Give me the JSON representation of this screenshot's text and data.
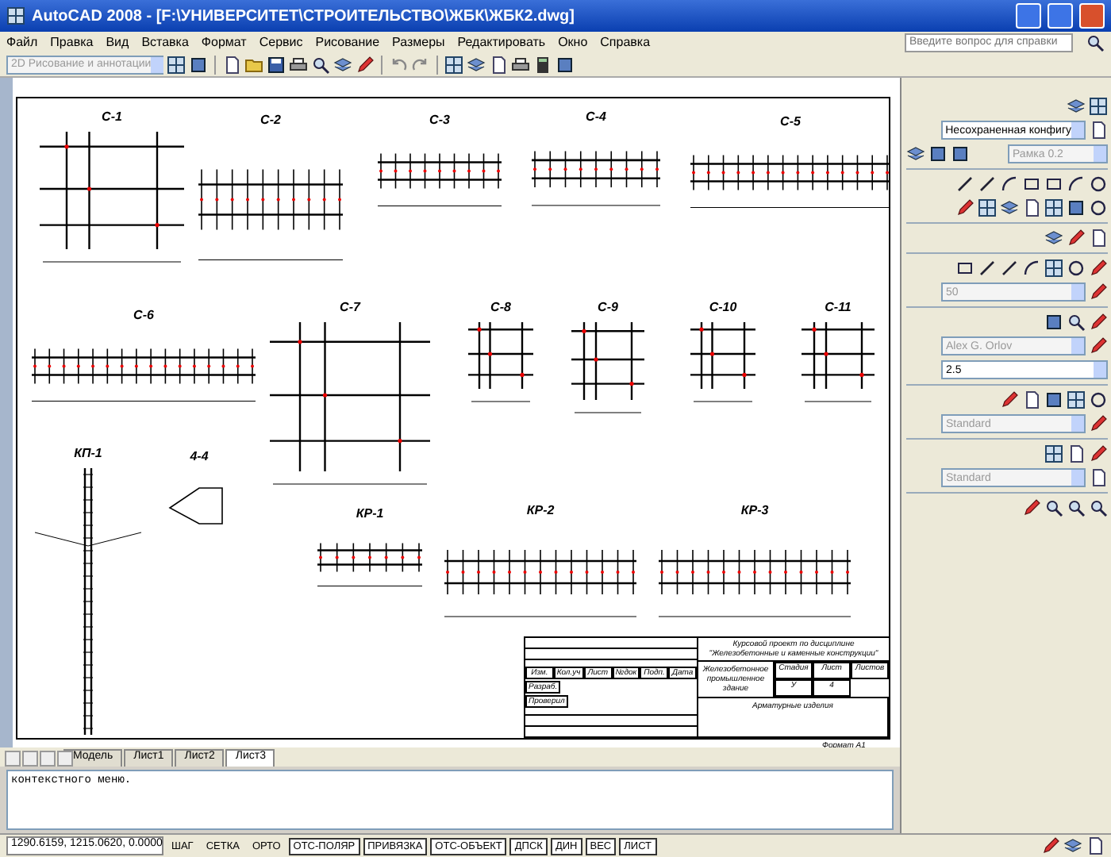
{
  "window": {
    "title": "AutoCAD 2008 - [F:\\УНИВЕРСИТЕТ\\СТРОИТЕЛЬСТВО\\ЖБК\\ЖБК2.dwg]"
  },
  "menu": [
    "Файл",
    "Правка",
    "Вид",
    "Вставка",
    "Формат",
    "Сервис",
    "Рисование",
    "Размеры",
    "Редактировать",
    "Окно",
    "Справка"
  ],
  "help_search": {
    "placeholder": "Введите вопрос для справки"
  },
  "workspace": {
    "value": "2D Рисование и аннотации"
  },
  "drawings": [
    {
      "label": "С-1",
      "kind": "mesh"
    },
    {
      "label": "С-2",
      "kind": "frame"
    },
    {
      "label": "С-3",
      "kind": "frame"
    },
    {
      "label": "С-4",
      "kind": "frame"
    },
    {
      "label": "С-5",
      "kind": "frame"
    },
    {
      "label": "С-6",
      "kind": "frame"
    },
    {
      "label": "С-7",
      "kind": "mesh"
    },
    {
      "label": "С-8",
      "kind": "mesh"
    },
    {
      "label": "С-9",
      "kind": "mesh"
    },
    {
      "label": "С-10",
      "kind": "mesh"
    },
    {
      "label": "С-11",
      "kind": "mesh"
    },
    {
      "label": "КП-1",
      "kind": "column"
    },
    {
      "label": "4-4",
      "kind": "detail"
    },
    {
      "label": "КР-1",
      "kind": "frame"
    },
    {
      "label": "КР-2",
      "kind": "frame"
    },
    {
      "label": "КР-3",
      "kind": "frame"
    }
  ],
  "title_block": {
    "header": [
      "Изм.",
      "Кол.уч",
      "Лист",
      "№док",
      "Подп.",
      "Дата"
    ],
    "roles": [
      "Разраб.",
      "Проверил"
    ],
    "project": "Курсовой проект по дисциплине",
    "discipline": "\"Железобетонные и каменные конструкции\"",
    "building": "Железобетонное промышленное здание",
    "stage_headers": [
      "Стадия",
      "Лист",
      "Листов"
    ],
    "stage_values": [
      "У",
      "4"
    ],
    "sheet_title": "Арматурные изделия",
    "format": "Формат А1"
  },
  "layout_tabs": [
    {
      "label": "Модель",
      "selected": false
    },
    {
      "label": "Лист1",
      "selected": false
    },
    {
      "label": "Лист2",
      "selected": false
    },
    {
      "label": "Лист3",
      "selected": true
    }
  ],
  "command_line": {
    "text": "контекстного меню."
  },
  "panel_combos": [
    {
      "value": "Несохраненная конфигу",
      "disabled": false
    },
    {
      "value": "Рамка 0.2",
      "disabled": true
    },
    {
      "value": "50",
      "disabled": true
    },
    {
      "value": "Alex G. Orlov",
      "disabled": true
    },
    {
      "value": "2.5",
      "disabled": false
    },
    {
      "value": "Standard",
      "disabled": true
    },
    {
      "value": "Standard",
      "disabled": true
    }
  ],
  "status_bar": {
    "coordinates": "1290.6159, 1215.0620, 0.0000",
    "toggles": [
      {
        "label": "ШАГ",
        "on": false
      },
      {
        "label": "СЕТКА",
        "on": false
      },
      {
        "label": "ОРТО",
        "on": false
      },
      {
        "label": "ОТС-ПОЛЯР",
        "on": true
      },
      {
        "label": "ПРИВЯЗКА",
        "on": true
      },
      {
        "label": "ОТС-ОБЪЕКТ",
        "on": true
      },
      {
        "label": "ДПСК",
        "on": true
      },
      {
        "label": "ДИН",
        "on": true
      },
      {
        "label": "ВЕС",
        "on": true
      },
      {
        "label": "ЛИСТ",
        "on": true
      }
    ]
  }
}
